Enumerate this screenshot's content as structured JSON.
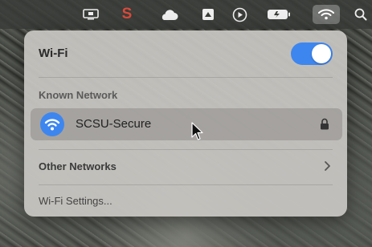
{
  "menubar": {
    "icons": [
      "display-icon",
      "scrobble-app-icon",
      "cloud-icon",
      "box-icon",
      "play-circle-icon",
      "battery-icon",
      "wifi-icon",
      "search-icon"
    ],
    "app_glyph": "S",
    "accent_color": "#d94a3b"
  },
  "wifi_panel": {
    "title": "Wi-Fi",
    "toggle_on": true,
    "toggle_color": "#3e86ef",
    "known_network_label": "Known Network",
    "known_networks": [
      {
        "name": "SCSU-Secure",
        "secured": true,
        "connected": true
      }
    ],
    "other_networks_label": "Other Networks",
    "settings_label": "Wi-Fi Settings..."
  }
}
